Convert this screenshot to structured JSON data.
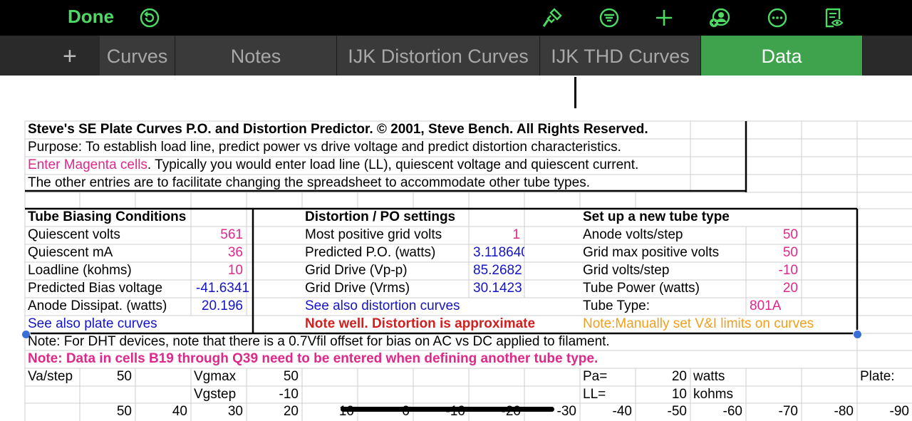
{
  "toolbar": {
    "done_label": "Done"
  },
  "tabs": [
    {
      "label": "Curves"
    },
    {
      "label": "Notes"
    },
    {
      "label": "IJK Distortion Curves"
    },
    {
      "label": "IJK THD Curves"
    },
    {
      "label": "Data"
    }
  ],
  "header": {
    "title": "Steve's SE Plate Curves P.O. and Distortion Predictor.  © 2001, Steve Bench. All Rights Reserved.",
    "purpose": "Purpose: To establish load line, predict power vs drive voltage and predict distortion characteristics.",
    "enter_magenta": "Enter Magenta cells",
    "enter_rest": ". Typically you would enter load line (LL), quiescent voltage and quiescent current.",
    "other": "The other entries are to facilitate changing the spreadsheet to accommodate other tube types."
  },
  "biasing": {
    "title": "Tube Biasing Conditions",
    "rows": [
      {
        "label": "Quiescent volts",
        "value": "561"
      },
      {
        "label": "Quiescent mA",
        "value": "36"
      },
      {
        "label": "Loadline (kohms)",
        "value": "10"
      },
      {
        "label": "Predicted Bias voltage",
        "value": "-41.6341"
      },
      {
        "label": "Anode Dissipat. (watts)",
        "value": "20.196"
      }
    ],
    "link": "See also plate curves"
  },
  "distortion": {
    "title": "Distortion / PO settings",
    "rows": [
      {
        "label": "Most positive grid volts",
        "value": "1"
      },
      {
        "label": "Predicted P.O. (watts)",
        "value": "3.118640"
      },
      {
        "label": "Grid Drive (Vp-p)",
        "value": "85.2682"
      },
      {
        "label": "Grid Drive (Vrms)",
        "value": "30.1423"
      }
    ],
    "link": "See also distortion curves",
    "note": "Note well. Distortion is approximate"
  },
  "newtube": {
    "title": "Set up a new tube type",
    "rows": [
      {
        "label": "Anode volts/step",
        "value": "50"
      },
      {
        "label": "Grid max positive volts",
        "value": "50"
      },
      {
        "label": "Grid volts/step",
        "value": "-10"
      },
      {
        "label": "Tube Power (watts)",
        "value": "20"
      },
      {
        "label": "Tube Type:",
        "value": "801A"
      }
    ],
    "note": "Note:Manually set V&I limits on curves"
  },
  "notes": {
    "dht": "Note: For DHT devices, note that there is a 0.7Vfil offset for bias on AC vs DC applied to filament.",
    "data": "Note: Data in cells B19 through Q39 need to be entered when defining another tube type."
  },
  "bottom": {
    "va_label": "Va/step",
    "va_value": "50",
    "vgmax_label": "Vgmax",
    "vgmax_value": "50",
    "vgstep_label": "Vgstep",
    "vgstep_value": "-10",
    "pa_label": "Pa=",
    "pa_value": "20",
    "pa_unit": "watts",
    "ll_label": "LL=",
    "ll_value": "10",
    "ll_unit": "kohms",
    "plate_label": "Plate:",
    "series": [
      "50",
      "40",
      "30",
      "20",
      "10",
      "0",
      "-10",
      "-20",
      "-30",
      "-40",
      "-50",
      "-60",
      "-70",
      "-80",
      "-90"
    ]
  },
  "colors": {
    "accent": "#4cd964",
    "active_tab": "#3fa34d",
    "magenta": "#e0288a",
    "blue": "#1414c8",
    "red": "#d02020",
    "orange": "#f0a020"
  }
}
